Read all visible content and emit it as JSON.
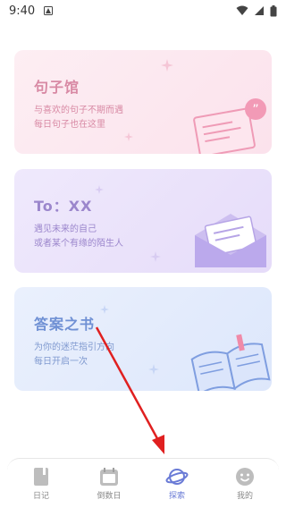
{
  "status_bar": {
    "time": "9:40"
  },
  "cards": [
    {
      "title": "句子馆",
      "subtitle_lines": [
        "与喜欢的句子不期而遇",
        "每日句子也在这里"
      ]
    },
    {
      "title": "To：XX",
      "subtitle_lines": [
        "遇见未来的自己",
        "或者某个有缘的陌生人"
      ]
    },
    {
      "title": "答案之书",
      "subtitle_lines": [
        "为你的迷茫指引方向",
        "每日开启一次"
      ]
    }
  ],
  "bottom_nav": {
    "items": [
      {
        "label": "日记",
        "icon": "diary-icon",
        "active": false
      },
      {
        "label": "倒数日",
        "icon": "countdown-icon",
        "active": false
      },
      {
        "label": "探索",
        "icon": "planet-icon",
        "active": true
      },
      {
        "label": "我的",
        "icon": "smile-icon",
        "active": false
      }
    ]
  },
  "colors": {
    "accent": "#6a7bd6",
    "arrow": "#e02020"
  }
}
